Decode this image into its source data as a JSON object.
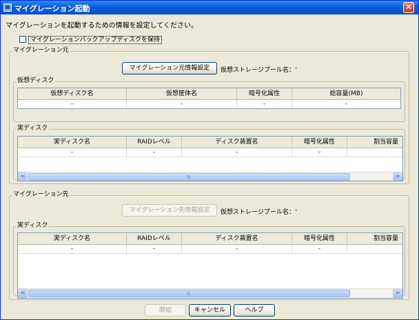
{
  "window": {
    "title": "マイグレーション起動",
    "close_glyph": "✕"
  },
  "instruction": "マイグレーションを起動するための情報を設定してください。",
  "keep_backup_label": "マイグレーションバックアップディスクを保持",
  "keep_backup_checked": false,
  "source": {
    "legend": "マイグレーション元",
    "info_button": "マイグレーション元情報設定",
    "pool_label": "仮想ストレージプール名：",
    "pool_value": "-",
    "virtual_disk": {
      "legend": "仮想ディスク",
      "columns": [
        "仮想ディスク名",
        "仮想筐体名",
        "暗号化属性",
        "総容量(MB)"
      ],
      "rows": [
        [
          "-",
          "-",
          "-",
          "-"
        ]
      ]
    },
    "real_disk": {
      "legend": "実ディスク",
      "columns": [
        "実ディスク名",
        "RAIDレベル",
        "ディスク装置名",
        "暗号化属性",
        "割当容量"
      ],
      "rows": [
        [
          "-",
          "-",
          "-",
          "-",
          "-"
        ]
      ]
    }
  },
  "dest": {
    "legend": "マイグレーション先",
    "info_button": "マイグレーション先情報設定",
    "pool_label": "仮想ストレージプール名：",
    "pool_value": "-",
    "real_disk": {
      "legend": "実ディスク",
      "columns": [
        "実ディスク名",
        "RAIDレベル",
        "ディスク装置名",
        "暗号化属性",
        "割当容量"
      ],
      "rows": [
        [
          "-",
          "-",
          "-",
          "-",
          "-"
        ]
      ]
    }
  },
  "buttons": {
    "start": "開始",
    "cancel": "キャンセル",
    "help": "ヘルプ"
  },
  "scrollbar": {
    "left": "<",
    "right": ">"
  }
}
